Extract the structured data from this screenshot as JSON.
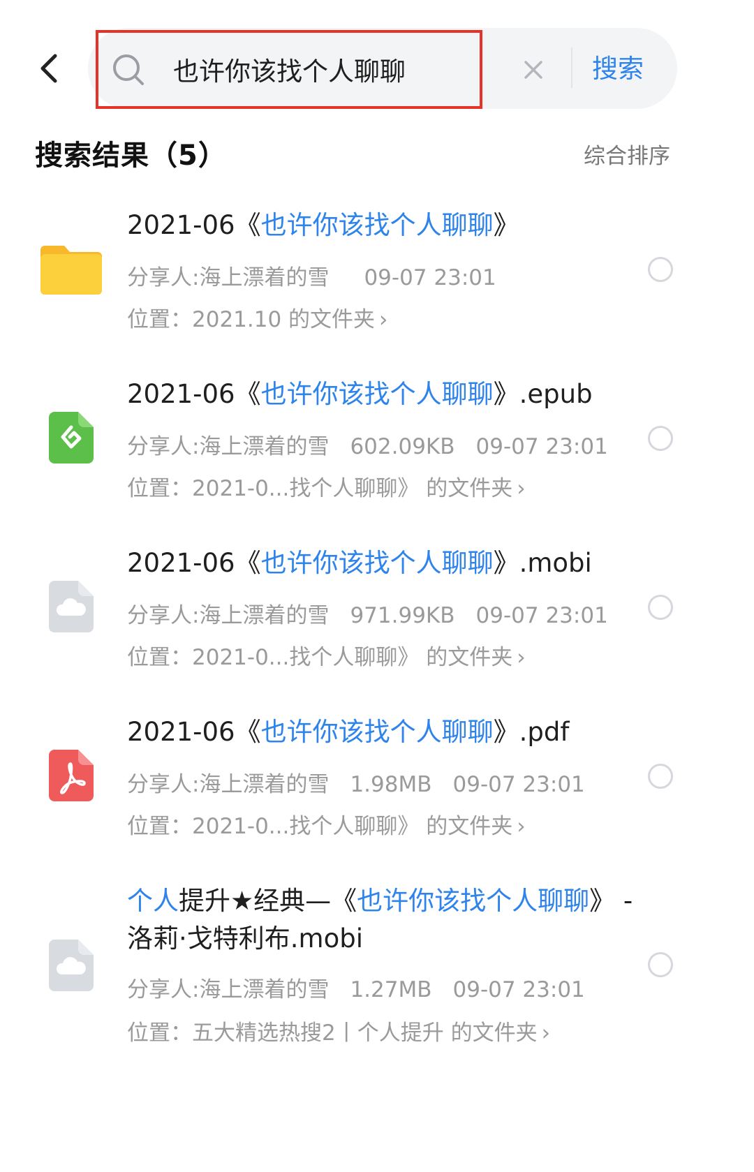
{
  "search": {
    "value": "也许你该找个人聊聊",
    "button_label": "搜索"
  },
  "results_header": {
    "title": "搜索结果（5）",
    "sort_label": "综合排序"
  },
  "items": [
    {
      "icon": "folder-icon",
      "title_prefix": "2021-06《",
      "title_keyword": "也许你该找个人聊聊",
      "title_suffix": "》",
      "sharer": "分享人:海上漂着的雪",
      "size": "",
      "time": "09-07 23:01",
      "location": "位置：2021.10 的文件夹"
    },
    {
      "icon": "epub-icon",
      "title_prefix": "2021-06《",
      "title_keyword": "也许你该找个人聊聊",
      "title_suffix": "》.epub",
      "sharer": "分享人:海上漂着的雪",
      "size": "602.09KB",
      "time": "09-07 23:01",
      "location": "位置：2021-0...找个人聊聊》 的文件夹"
    },
    {
      "icon": "cloud-file-icon",
      "title_prefix": "2021-06《",
      "title_keyword": "也许你该找个人聊聊",
      "title_suffix": "》.mobi",
      "sharer": "分享人:海上漂着的雪",
      "size": "971.99KB",
      "time": "09-07 23:01",
      "location": "位置：2021-0...找个人聊聊》 的文件夹"
    },
    {
      "icon": "pdf-icon",
      "title_prefix": "2021-06《",
      "title_keyword": "也许你该找个人聊聊",
      "title_suffix": "》.pdf",
      "sharer": "分享人:海上漂着的雪",
      "size": "1.98MB",
      "time": "09-07 23:01",
      "location": "位置：2021-0...找个人聊聊》 的文件夹"
    },
    {
      "icon": "cloud-file-icon",
      "title_keyword_a": "个人",
      "title_middle": "提升★经典—《",
      "title_keyword": "也许你该找个人聊聊",
      "title_suffix": "》 - 洛莉·戈特利布.mobi",
      "sharer": "分享人:海上漂着的雪",
      "size": "1.27MB",
      "time": "09-07 23:01",
      "location": "位置：五大精选热搜2丨个人提升 的文件夹"
    }
  ],
  "colors": {
    "accent": "#2f84ec",
    "highlight_border": "#e5332a",
    "folder": "#fcc933",
    "epub": "#5cbf49",
    "pdf": "#ef5a5a",
    "cloud_file": "#d8dbe0"
  }
}
